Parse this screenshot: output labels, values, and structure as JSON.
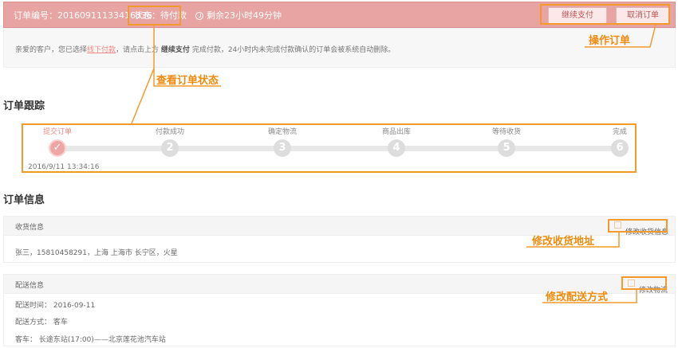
{
  "top": {
    "order_no": "订单编号：20160911133416336",
    "status": "状态：待付款",
    "remaining": "剩余23小时49分钟",
    "pay_btn": "继续支付",
    "cancel_btn": "取消订单"
  },
  "notice": {
    "pre": "亲爱的客户，您已选择",
    "link": "线下付款",
    "mid": "，请点击上方",
    "strong": "继续支付",
    "post": "完成付款，24小时内未完成付款确认的订单会被系统自动删除。"
  },
  "tracking": {
    "title": "订单跟踪",
    "steps": [
      {
        "label": "提交订单",
        "num": "✓",
        "active": true
      },
      {
        "label": "付款成功",
        "num": "2",
        "active": false
      },
      {
        "label": "确定物流",
        "num": "3",
        "active": false
      },
      {
        "label": "商品出库",
        "num": "4",
        "active": false
      },
      {
        "label": "等待收货",
        "num": "5",
        "active": false
      },
      {
        "label": "完成",
        "num": "6",
        "active": false
      }
    ],
    "date": "2016/9/11 13:34:16"
  },
  "info": {
    "title": "订单信息",
    "receive": {
      "head": "收货信息",
      "edit": "修改收货信息",
      "text": "张三，15810458291，上海 上海市 长宁区，火星"
    },
    "delivery": {
      "head": "配送信息",
      "edit": "修改物流",
      "time": "配送时间：   2016-09-11",
      "method": "配送方式：   客车",
      "bus": "客车：   长途东站(17:00)——北京莲花池汽车站"
    }
  },
  "annotations": {
    "operate": "操作订单",
    "view_status": "查看订单状态",
    "modify_address": "修改收货地址",
    "modify_delivery": "修改配送方式"
  },
  "colors": {
    "header_bg": "#e8a3a3",
    "annotation": "#ef8a0c",
    "step_active": "#f0a5a5"
  }
}
